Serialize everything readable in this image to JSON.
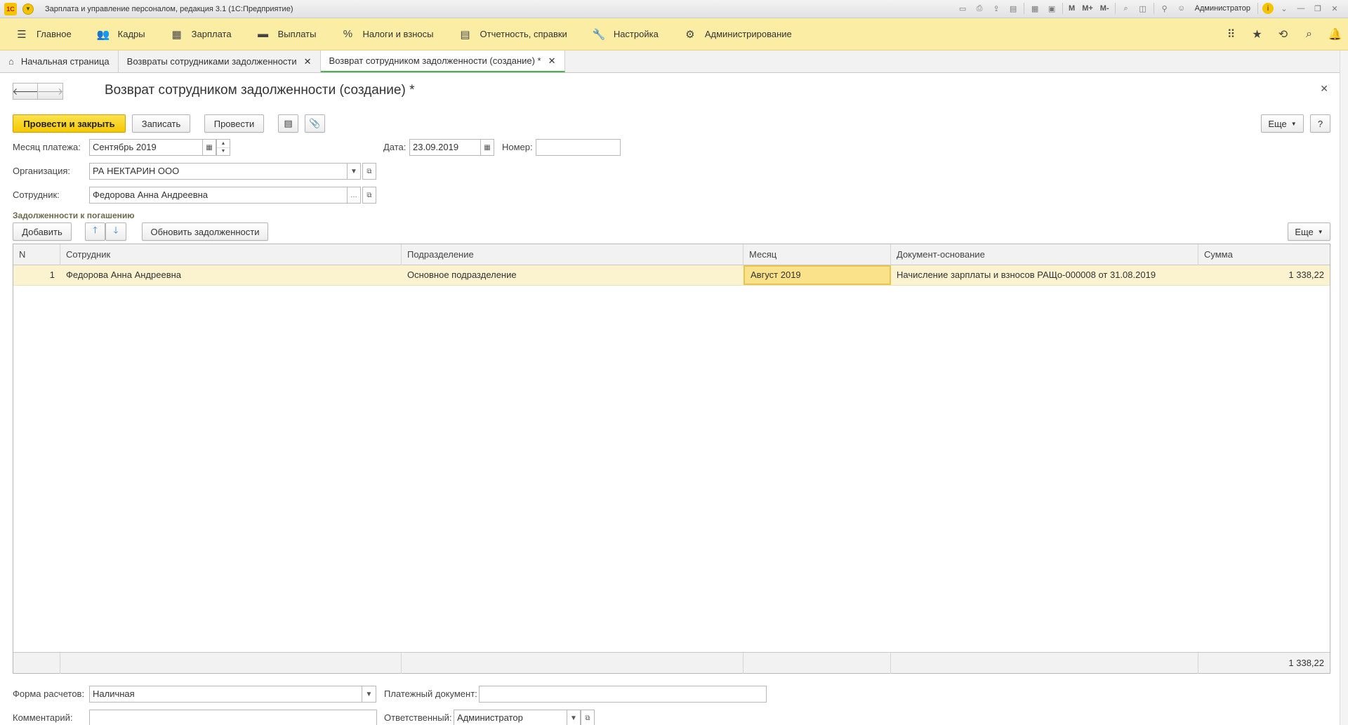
{
  "window": {
    "title": "Зарплата и управление персоналом, редакция 3.1  (1С:Предприятие)",
    "logo_text": "1С",
    "user": "Администратор",
    "tools": [
      "M",
      "M+",
      "M-"
    ]
  },
  "sections": [
    {
      "label": "Главное",
      "icon": "menu-icon"
    },
    {
      "label": "Кадры",
      "icon": "people-icon"
    },
    {
      "label": "Зарплата",
      "icon": "calculator-icon"
    },
    {
      "label": "Выплаты",
      "icon": "wallet-icon"
    },
    {
      "label": "Налоги и взносы",
      "icon": "percent-icon"
    },
    {
      "label": "Отчетность, справки",
      "icon": "reports-icon"
    },
    {
      "label": "Настройка",
      "icon": "wrench-icon"
    },
    {
      "label": "Администрирование",
      "icon": "gear-icon"
    }
  ],
  "tabs": [
    {
      "label": "Начальная страница"
    },
    {
      "label": "Возвраты сотрудниками задолженности"
    },
    {
      "label": "Возврат сотрудником задолженности (создание) *"
    }
  ],
  "form": {
    "title": "Возврат сотрудником задолженности (создание) *",
    "buttons": {
      "post_close": "Провести и закрыть",
      "save": "Записать",
      "post": "Провести",
      "more": "Еще",
      "help": "?"
    },
    "fields": {
      "payment_month_label": "Месяц платежа:",
      "payment_month_value": "Сентябрь 2019",
      "date_label": "Дата:",
      "date_value": "23.09.2019",
      "number_label": "Номер:",
      "number_value": "",
      "org_label": "Организация:",
      "org_value": "РА НЕКТАРИН ООО",
      "employee_label": "Сотрудник:",
      "employee_value": "Федорова Анна Андреевна"
    },
    "group_title": "Задолженности к погашению",
    "table_buttons": {
      "add": "Добавить",
      "refresh": "Обновить задолженности",
      "more": "Еще"
    },
    "table": {
      "columns": [
        "N",
        "Сотрудник",
        "Подразделение",
        "Месяц",
        "Документ-основание",
        "Сумма"
      ],
      "rows": [
        {
          "n": "1",
          "employee": "Федорова Анна Андреевна",
          "department": "Основное подразделение",
          "month": "Август 2019",
          "document": "Начисление зарплаты и взносов РАЩо-000008 от 31.08.2019",
          "sum": "1 338,22"
        }
      ],
      "total": "1 338,22"
    },
    "bottom": {
      "payment_form_label": "Форма расчетов:",
      "payment_form_value": "Наличная",
      "payment_doc_label": "Платежный документ:",
      "payment_doc_value": "",
      "comment_label": "Комментарий:",
      "comment_value": "",
      "responsible_label": "Ответственный:",
      "responsible_value": "Администратор"
    }
  }
}
